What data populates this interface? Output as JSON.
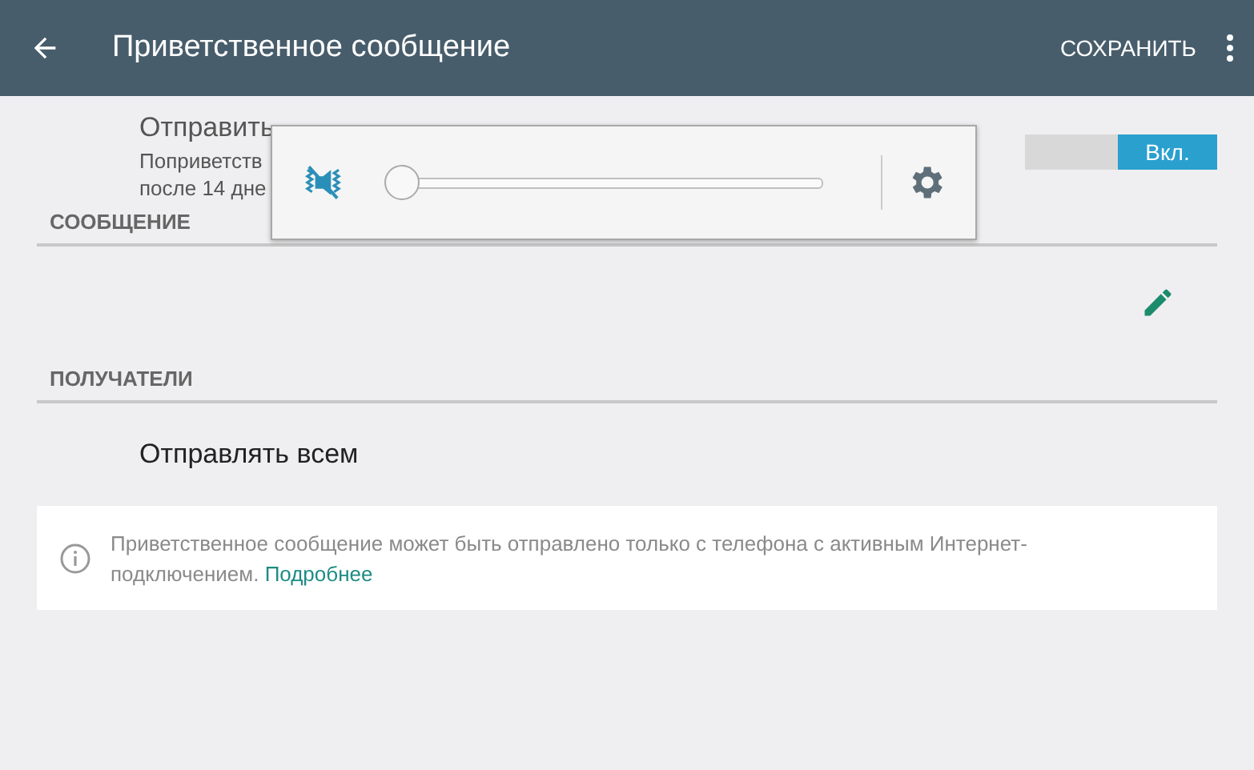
{
  "app_bar": {
    "title": "Приветственное сообщение",
    "action": "СОХРАНИТЬ"
  },
  "greeting_setting": {
    "title": "Отправить",
    "subtitle_lines": [
      "Поприветств",
      "после 14 дне"
    ],
    "toggle": {
      "label": "Вкл.",
      "on": true
    }
  },
  "message_section": {
    "header": "СООБЩЕНИЕ"
  },
  "recipients_section": {
    "header": "ПОЛУЧАТЕЛИ",
    "option": "Отправлять всем"
  },
  "info_card": {
    "text": "Приветственное сообщение может быть отправлено только с телефона с активным Интернет-подключением.",
    "link": "Подробнее"
  },
  "volume_popup": {
    "level": 0
  }
}
